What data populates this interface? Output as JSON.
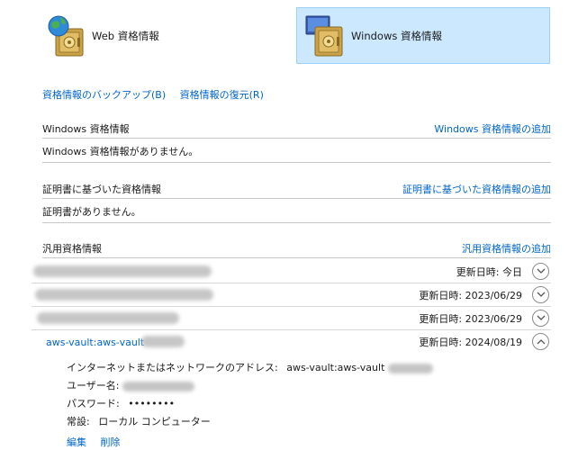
{
  "tabs": {
    "web": {
      "label": "Web 資格情報",
      "icon": "web-credentials-icon"
    },
    "windows": {
      "label": "Windows 資格情報",
      "icon": "windows-credentials-icon",
      "selected": true
    }
  },
  "links": {
    "backup": "資格情報のバックアップ(B)",
    "restore": "資格情報の復元(R)"
  },
  "sections": {
    "windows": {
      "title": "Windows 資格情報",
      "add_link": "Windows 資格情報の追加",
      "empty": "Windows 資格情報がありません。"
    },
    "certificate": {
      "title": "証明書に基づいた資格情報",
      "add_link": "証明書に基づいた資格情報の追加",
      "empty": "証明書がありません。"
    },
    "generic": {
      "title": "汎用資格情報",
      "add_link": "汎用資格情報の追加"
    }
  },
  "generic_rows": [
    {
      "name": "",
      "date": "更新日時:  今日",
      "expanded": false
    },
    {
      "name": "",
      "date": "更新日時:  2023/06/29",
      "expanded": false
    },
    {
      "name": "",
      "date": "更新日時:  2023/06/29",
      "expanded": false
    },
    {
      "name": "aws-vault:aws-vault",
      "date": "更新日時:  2024/08/19",
      "expanded": true
    }
  ],
  "details": {
    "address_label": "インターネットまたはネットワークのアドレス:",
    "address_value": "aws-vault:aws-vault",
    "user_label": "ユーザー名:",
    "password_label": "パスワード:",
    "password_value": "••••••••",
    "persistence_label": "常設:",
    "persistence_value": "ローカル コンピューター"
  },
  "actions": {
    "edit": "編集",
    "delete": "削除"
  },
  "colors": {
    "link": "#0066cc",
    "selected_tab": "#cce8ff",
    "selected_tab_border": "#99d1ff"
  }
}
